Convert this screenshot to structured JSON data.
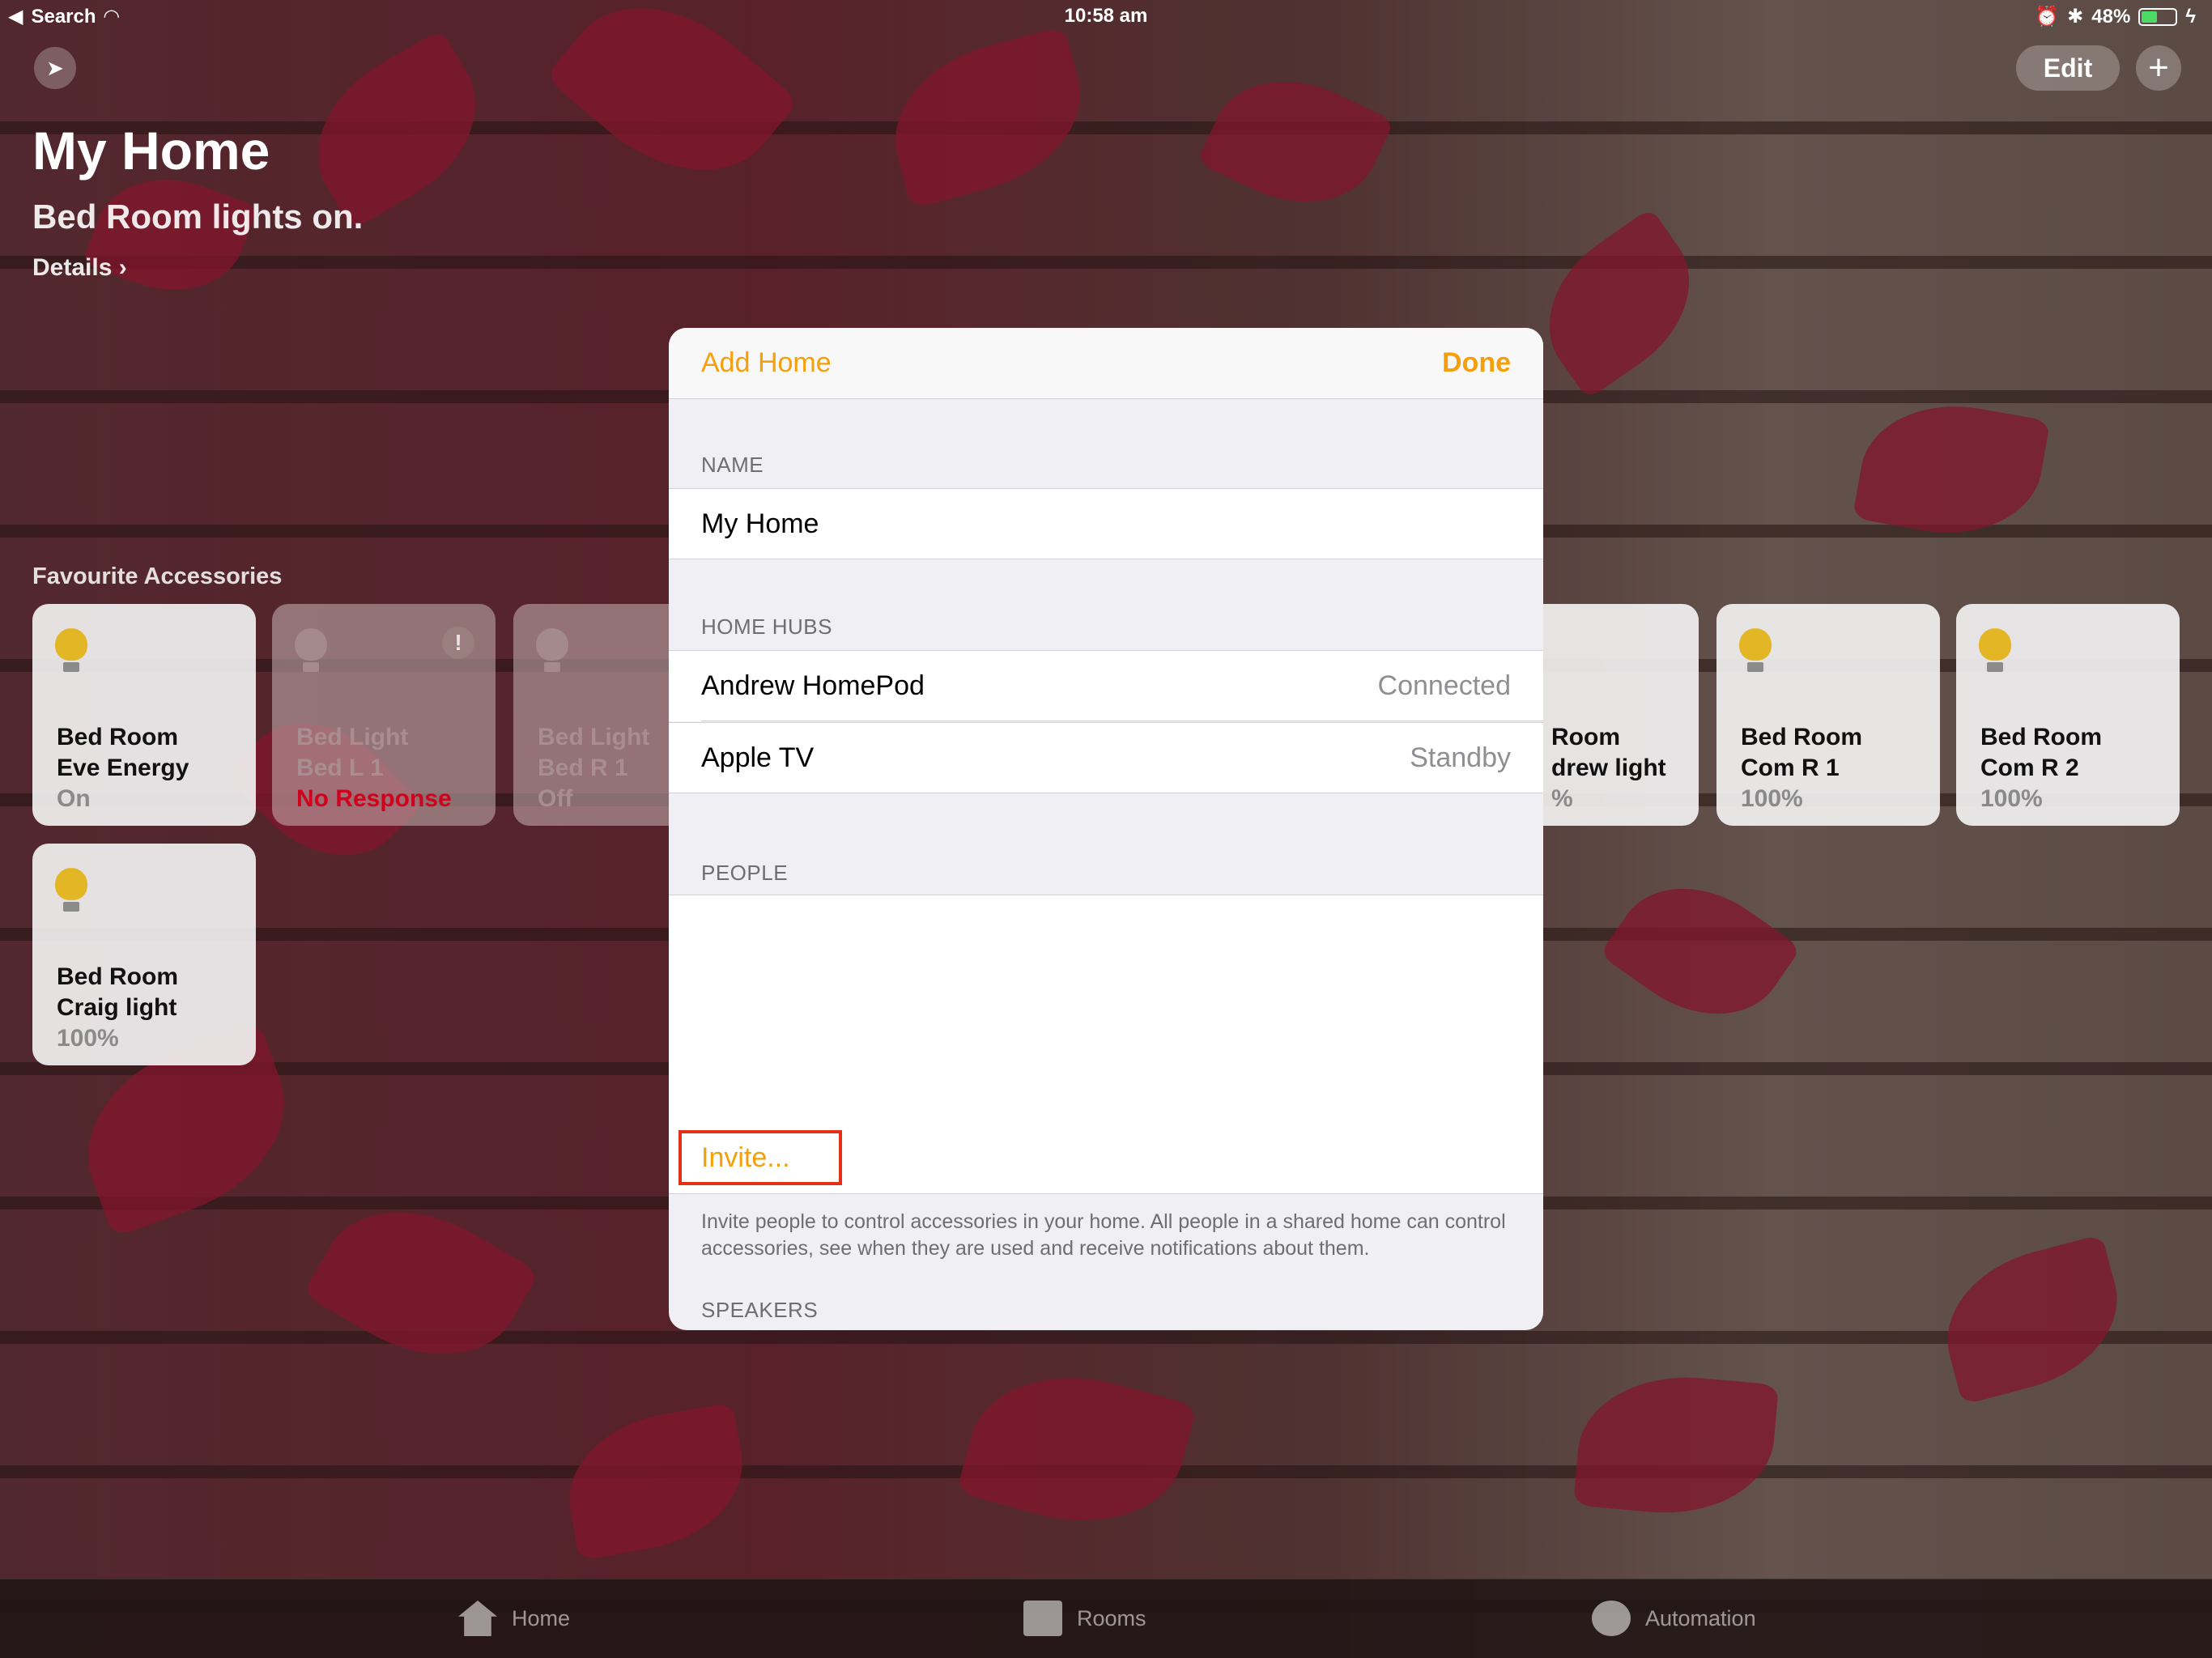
{
  "status_bar": {
    "back_app": "Search",
    "time": "10:58 am",
    "battery": "48%",
    "battery_level": 0.48
  },
  "home": {
    "title": "My Home",
    "subtitle": "Bed Room lights on.",
    "details": "Details ›",
    "edit_label": "Edit",
    "add_label": "+",
    "favourites_label": "Favourite Accessories"
  },
  "tiles": [
    {
      "name1": "Bed Room",
      "name2": "Eve Energy",
      "state": "On"
    },
    {
      "name1": "Bed Light",
      "name2": "Bed L 1",
      "state": "No Response"
    },
    {
      "name1": "Bed Light",
      "name2": "Bed R 1",
      "state": "Off"
    },
    {
      "name1": "Room",
      "name2": "drew light",
      "state": "%"
    },
    {
      "name1": "Bed Room",
      "name2": "Com R 1",
      "state": "100%"
    },
    {
      "name1": "Bed Room",
      "name2": "Com R 2",
      "state": "100%"
    },
    {
      "name1": "Bed Room",
      "name2": "Craig light",
      "state": "100%"
    }
  ],
  "modal": {
    "title": "Add Home",
    "done": "Done",
    "name_section": "NAME",
    "name_value": "My Home",
    "hubs_section": "HOME HUBS",
    "hubs": [
      {
        "name": "Andrew HomePod",
        "status": "Connected"
      },
      {
        "name": "Apple TV",
        "status": "Standby"
      }
    ],
    "people_section": "PEOPLE",
    "invite": "Invite...",
    "invite_note": "Invite people to control accessories in your home. All people in a shared home can control accessories, see when they are used and receive notifications about them.",
    "speakers_section": "SPEAKERS"
  },
  "tabbar": {
    "home": "Home",
    "rooms": "Rooms",
    "automation": "Automation"
  },
  "colors": {
    "accent": "#f59f0a",
    "alert": "#d0021b",
    "highlight_box": "#e53019"
  }
}
